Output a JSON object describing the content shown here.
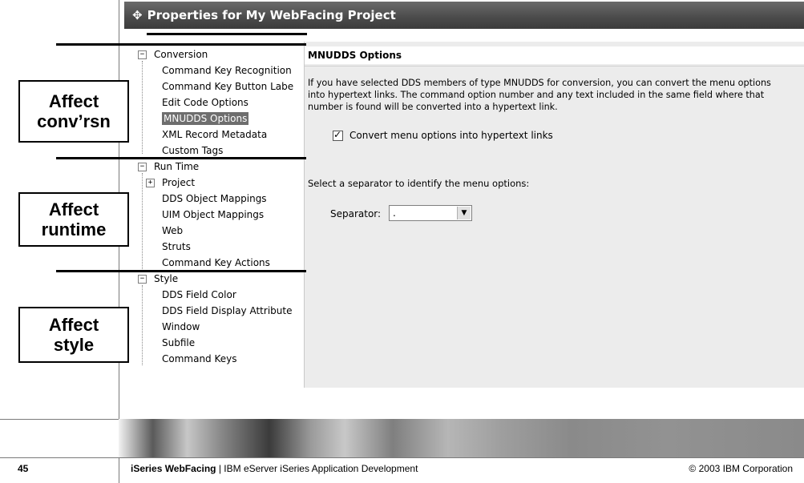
{
  "dialog": {
    "title": "Properties for My WebFacing Project"
  },
  "nav": {
    "groups": [
      {
        "label": "Conversion",
        "items": [
          "Command Key Recognition",
          "Command Key Button Labe",
          "Edit Code Options",
          "MNUDDS Options",
          "XML Record Metadata",
          "Custom Tags"
        ]
      },
      {
        "label": "Run Time",
        "items": [
          "Project",
          "DDS Object Mappings",
          "UIM Object Mappings",
          "Web",
          "Struts",
          "Command Key Actions"
        ]
      },
      {
        "label": "Style",
        "items": [
          "DDS Field Color",
          "DDS Field Display Attribute",
          "Window",
          "Subfile",
          "Command Keys"
        ]
      }
    ],
    "selected": "MNUDDS Options"
  },
  "content": {
    "header": "MNUDDS Options",
    "description": "If you have selected DDS members of type MNUDDS for conversion, you can convert the menu options into hypertext links.  The command option number and any text included in the same field where that number is found will be converted into a hypertext link.",
    "convert_checkbox_label": "Convert menu options into hypertext links",
    "convert_checked": true,
    "separator_prompt": "Select a separator to identify the menu options:",
    "separator_label": "Separator:",
    "separator_value": "."
  },
  "callouts": {
    "conversion": [
      "Affect",
      "conv’rsn"
    ],
    "runtime": [
      "Affect",
      "runtime"
    ],
    "style": [
      "Affect",
      "style"
    ]
  },
  "footer": {
    "slide_number": "45",
    "product": "iSeries WebFacing",
    "subtitle": "IBM eServer iSeries Application Development",
    "copyright": "© 2003 IBM Corporation"
  }
}
